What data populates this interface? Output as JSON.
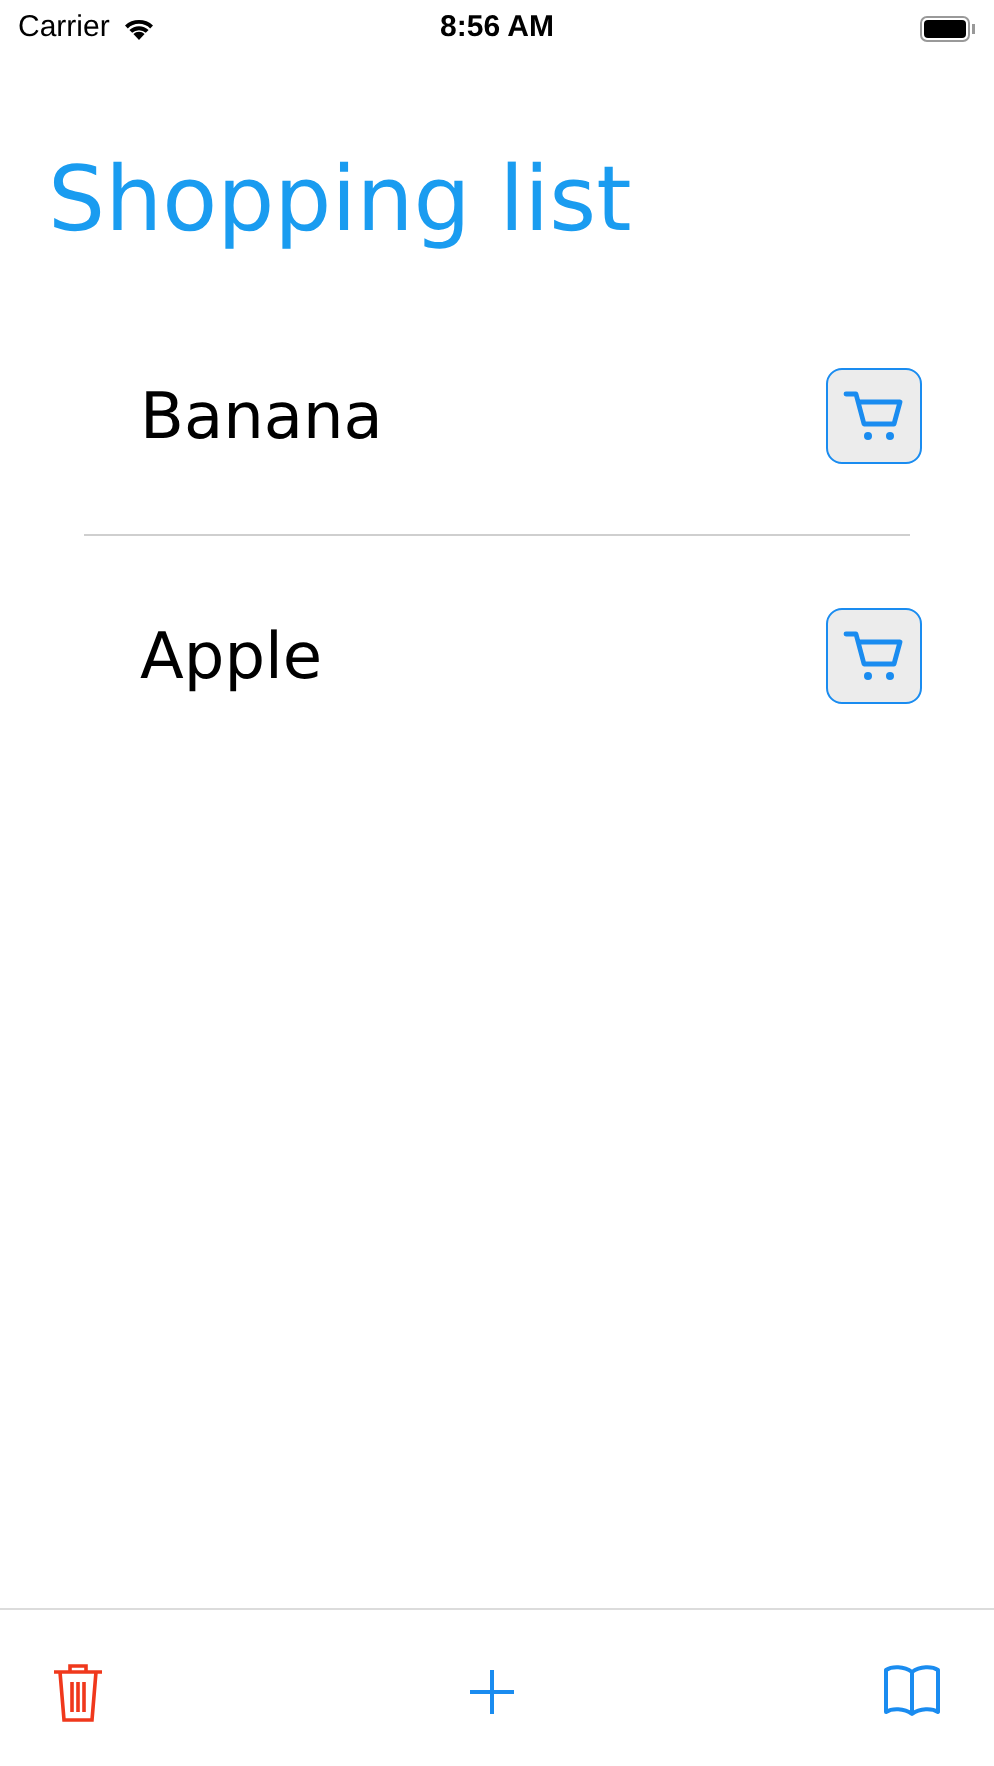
{
  "status_bar": {
    "carrier": "Carrier",
    "time": "8:56 AM"
  },
  "title": "Shopping list",
  "items": [
    {
      "name": "Banana"
    },
    {
      "name": "Apple"
    }
  ]
}
